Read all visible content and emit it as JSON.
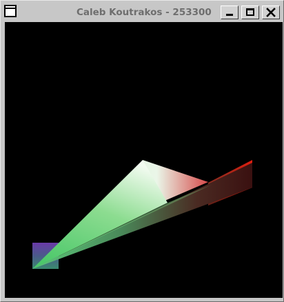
{
  "window": {
    "title": "Caleb Koutrakos - 253300",
    "system_menu_icon": "window-menu-icon",
    "controls": {
      "minimize_icon": "minimize-icon",
      "maximize_icon": "maximize-icon",
      "close_icon": "close-icon"
    }
  },
  "viewport": {
    "background": "#000000",
    "shapes": [
      {
        "name": "white-red-triangle",
        "colors": [
          "#f2fbf0",
          "#e53a1e",
          "#66b866"
        ]
      },
      {
        "name": "red-quad",
        "colors": [
          "#e21f12",
          "#a81010"
        ]
      },
      {
        "name": "purple-quad",
        "colors": [
          "#6a3a9e",
          "#3a7a6a"
        ]
      },
      {
        "name": "green-shaded-triangle",
        "colors": [
          "#66d07a",
          "#2a2a20"
        ]
      }
    ]
  }
}
